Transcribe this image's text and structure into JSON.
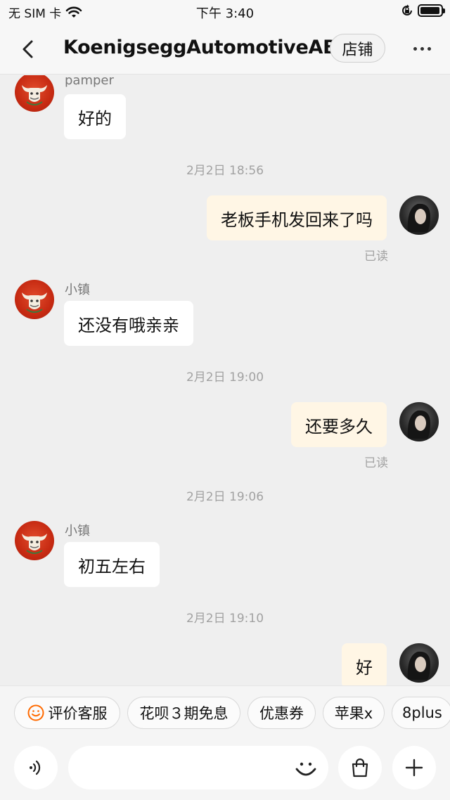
{
  "status_bar": {
    "carrier": "无 SIM 卡",
    "time": "下午 3:40",
    "battery_level": 0.95
  },
  "nav": {
    "title": "KoenigseggAutomotiveAB",
    "shop_label": "店铺"
  },
  "messages": [
    {
      "sender": "pamper",
      "text": "好的"
    },
    {
      "time": "2月2日 18:56"
    },
    {
      "text": "老板手机发回来了吗",
      "status": "已读"
    },
    {
      "sender": "小镇",
      "text": "还没有哦亲亲"
    },
    {
      "time": "2月2日 19:00"
    },
    {
      "text": "还要多久",
      "status": "已读"
    },
    {
      "time": "2月2日 19:06"
    },
    {
      "sender": "小镇",
      "text": "初五左右"
    },
    {
      "time": "2月2日 19:10"
    },
    {
      "text": "好"
    }
  ],
  "quick_replies": [
    {
      "label": "评价客服",
      "icon": "smiley-icon"
    },
    {
      "label": "花呗３期免息"
    },
    {
      "label": "优惠券"
    },
    {
      "label": "苹果x"
    },
    {
      "label": "8plus"
    }
  ],
  "input": {
    "placeholder": ""
  },
  "colors": {
    "background": "#efefef",
    "incoming_bubble": "#ffffff",
    "outgoing_bubble": "#fff6e5",
    "accent_orange": "#ff6a00"
  }
}
